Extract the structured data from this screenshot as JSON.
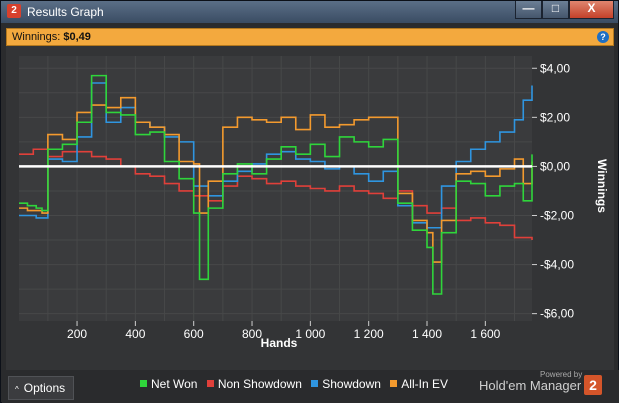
{
  "window": {
    "title": "Results Graph",
    "app_badge": "2",
    "minimize": "—",
    "maximize": "□",
    "close": "X"
  },
  "summary": {
    "label": "Winnings:",
    "value": "$0,49",
    "help": "?"
  },
  "chart_data": {
    "type": "line",
    "xlabel": "Hands",
    "ylabel": "Winnings",
    "xlim": [
      1,
      1760
    ],
    "ylim": [
      -6.3,
      4.5
    ],
    "x_ticks": [
      200,
      400,
      600,
      800,
      1000,
      1200,
      1400,
      1600
    ],
    "x_tick_labels": [
      "200",
      "400",
      "600",
      "800",
      "1 000",
      "1 200",
      "1 400",
      "1 600"
    ],
    "y_ticks": [
      4,
      2,
      0,
      -2,
      -4,
      -6
    ],
    "y_tick_labels": [
      "$4,00",
      "$2,00",
      "$0,00",
      "-$2,00",
      "-$4,00",
      "-$6,00"
    ],
    "grid": true,
    "zero_line": true,
    "series": [
      {
        "name": "Non Showdown",
        "color": "#e0403a",
        "x": [
          1,
          50,
          100,
          150,
          200,
          250,
          300,
          350,
          400,
          450,
          500,
          550,
          600,
          650,
          700,
          750,
          800,
          850,
          900,
          950,
          1000,
          1050,
          1100,
          1150,
          1200,
          1250,
          1300,
          1350,
          1400,
          1450,
          1500,
          1550,
          1600,
          1650,
          1700,
          1760
        ],
        "y": [
          0.5,
          0.7,
          0.4,
          0.6,
          0.6,
          0.4,
          0.3,
          0.0,
          -0.3,
          -0.4,
          -0.7,
          -1.0,
          -1.2,
          -1.4,
          -0.8,
          -0.4,
          -0.5,
          -0.7,
          -0.6,
          -0.8,
          -0.9,
          -1.0,
          -0.8,
          -1.0,
          -1.1,
          -1.3,
          -1.0,
          -1.6,
          -1.9,
          -1.7,
          -2.2,
          -2.1,
          -2.3,
          -2.4,
          -2.9,
          -3.0
        ]
      },
      {
        "name": "Showdown",
        "color": "#2f95e0",
        "x": [
          1,
          30,
          60,
          80,
          100,
          150,
          200,
          250,
          300,
          350,
          400,
          450,
          500,
          550,
          600,
          650,
          700,
          750,
          800,
          850,
          900,
          950,
          1000,
          1050,
          1100,
          1150,
          1200,
          1250,
          1300,
          1350,
          1400,
          1450,
          1500,
          1550,
          1600,
          1650,
          1700,
          1730,
          1760
        ],
        "y": [
          -2.0,
          -2.0,
          -2.1,
          -2.1,
          0.3,
          0.2,
          1.2,
          3.4,
          1.8,
          2.4,
          1.8,
          1.6,
          1.2,
          1.0,
          -0.8,
          -1.2,
          -0.6,
          -0.2,
          0.1,
          0.5,
          0.6,
          0.3,
          0.2,
          -0.1,
          0.0,
          -0.3,
          -0.6,
          -0.2,
          -1.6,
          -2.3,
          -2.5,
          -0.8,
          0.2,
          0.7,
          1.0,
          1.4,
          1.9,
          2.7,
          3.3
        ]
      },
      {
        "name": "Net Won",
        "color": "#2fd53b",
        "x": [
          1,
          30,
          60,
          80,
          100,
          150,
          200,
          250,
          300,
          350,
          400,
          450,
          500,
          550,
          600,
          620,
          650,
          700,
          750,
          800,
          850,
          900,
          950,
          1000,
          1050,
          1100,
          1150,
          1200,
          1250,
          1300,
          1350,
          1400,
          1420,
          1450,
          1500,
          1550,
          1600,
          1650,
          1700,
          1730,
          1760
        ],
        "y": [
          -1.5,
          -1.6,
          -1.7,
          -1.8,
          0.7,
          0.9,
          1.8,
          3.7,
          2.2,
          2.1,
          1.3,
          1.4,
          0.2,
          -0.5,
          -1.9,
          -4.6,
          -1.7,
          -0.3,
          0.1,
          -0.3,
          0.3,
          0.8,
          0.5,
          0.9,
          0.4,
          1.2,
          1.0,
          0.8,
          1.1,
          -1.5,
          -2.6,
          -3.3,
          -5.2,
          -2.7,
          -0.6,
          -0.7,
          -1.2,
          -0.8,
          -0.7,
          -1.4,
          0.49
        ]
      },
      {
        "name": "All-In EV",
        "color": "#f39a2e",
        "x": [
          1,
          30,
          60,
          80,
          100,
          150,
          200,
          250,
          300,
          350,
          400,
          450,
          500,
          550,
          600,
          620,
          650,
          700,
          750,
          800,
          850,
          900,
          950,
          1000,
          1050,
          1100,
          1150,
          1200,
          1250,
          1300,
          1350,
          1400,
          1420,
          1450,
          1500,
          1550,
          1600,
          1650,
          1700,
          1730,
          1760
        ],
        "y": [
          -1.7,
          -1.8,
          -1.8,
          -1.9,
          1.3,
          1.1,
          2.2,
          2.5,
          2.4,
          2.8,
          1.8,
          1.6,
          1.3,
          0.2,
          0.1,
          -1.9,
          -0.6,
          1.6,
          2.0,
          1.9,
          1.8,
          2.0,
          1.5,
          2.1,
          1.6,
          1.7,
          1.9,
          2.0,
          2.0,
          -1.1,
          -2.2,
          -2.7,
          -3.9,
          -2.2,
          -0.3,
          -0.2,
          -0.4,
          -0.1,
          0.3,
          -0.7,
          0.2
        ]
      }
    ]
  },
  "options": {
    "label": "Options",
    "caret": "^"
  },
  "legend": [
    {
      "label": "Net Won",
      "color": "#2fd53b"
    },
    {
      "label": "Non Showdown",
      "color": "#e0403a"
    },
    {
      "label": "Showdown",
      "color": "#2f95e0"
    },
    {
      "label": "All-In EV",
      "color": "#f39a2e"
    }
  ],
  "branding": {
    "powered_by": "Powered by",
    "name": "Hold'em Manager",
    "badge": "2"
  }
}
